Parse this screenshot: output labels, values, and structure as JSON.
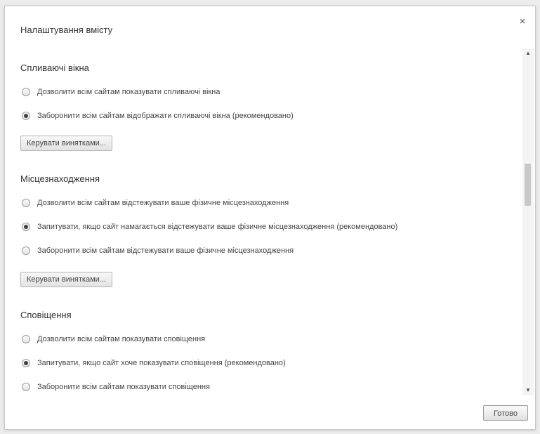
{
  "dialog": {
    "title": "Налаштування вмісту",
    "close_label": "×",
    "done_label": "Готово"
  },
  "sections": [
    {
      "title": "Спливаючі вікна",
      "options": [
        {
          "label": "Дозволити всім сайтам показувати спливаючі вікна",
          "checked": false
        },
        {
          "label": "Заборонити всім сайтам відображати спливаючі вікна (рекомендовано)",
          "checked": true
        }
      ],
      "button": "Керувати винятками..."
    },
    {
      "title": "Місцезнаходження",
      "options": [
        {
          "label": "Дозволити всім сайтам відстежувати ваше фізичне місцезнаходження",
          "checked": false
        },
        {
          "label": "Запитувати, якщо сайт намагається відстежувати ваше фізичне місцезнаходження (рекомендовано)",
          "checked": true
        },
        {
          "label": "Заборонити всім сайтам відстежувати ваше фізичне місцезнаходження",
          "checked": false
        }
      ],
      "button": "Керувати винятками..."
    },
    {
      "title": "Сповіщення",
      "options": [
        {
          "label": "Дозволити всім сайтам показувати сповіщення",
          "checked": false
        },
        {
          "label": "Запитувати, якщо сайт хоче показувати сповіщення (рекомендовано)",
          "checked": true
        },
        {
          "label": "Заборонити всім сайтам показувати сповіщення",
          "checked": false
        }
      ]
    }
  ],
  "scrollbar": {
    "up_icon": "▲",
    "down_icon": "▼"
  }
}
